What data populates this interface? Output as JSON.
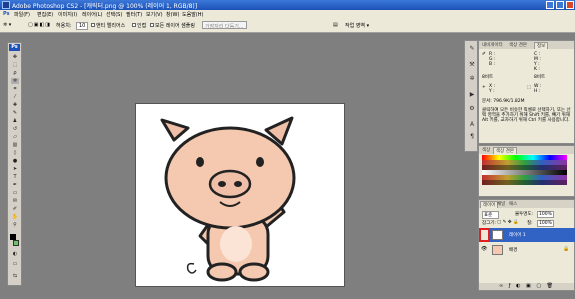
{
  "window": {
    "title": "Adobe Photoshop CS2 - [캐릭터.png @ 100% (레이어 1, RGB/8)]"
  },
  "menu": [
    "파일(F)",
    "편집(E)",
    "이미지(I)",
    "레이어(L)",
    "선택(S)",
    "필터(T)",
    "보기(V)",
    "창(W)",
    "도움말(H)"
  ],
  "options": {
    "tolerance_label": "허용치:",
    "tolerance_value": "10",
    "antialias": "앤티 앨리어스",
    "contiguous": "인접",
    "all_layers": "모든 레이어 샘플링",
    "refine_edge": "가장자리 다듬기...",
    "workspace": "작업 영역 ▾"
  },
  "panels": {
    "navigator": {
      "tabs": [
        "내비게이터",
        "색상 견본",
        "정보"
      ],
      "info": {
        "r": "R :",
        "g": "G :",
        "b": "B :",
        "c": "C :",
        "m": "M :",
        "y": "Y :",
        "k": "K :",
        "bit1": "8비트",
        "bit2": "8비트",
        "x": "X :",
        "y2": "Y :",
        "w": "W :",
        "h": "H :"
      },
      "doc": "문서: 796.9K/1.82M",
      "hint": "클릭하여 모든 비슷한 픽셀로 선택하기, 또는 선택 영역을 추가하기 위해 Shift 키를, 빼기 위해 Alt 키를, 교차하기 위해 Ctrl 키를 사용합니다."
    },
    "swatches": {
      "tabs": [
        "색상",
        "색상 견본"
      ]
    },
    "layers": {
      "tabs": [
        "레이어",
        "채널",
        "패스"
      ],
      "blend": "표준",
      "opacity_label": "불투명도:",
      "opacity_value": "100%",
      "lock_label": "잠그기:",
      "fill_label": "칠:",
      "fill_value": "100%",
      "items": [
        {
          "name": "레이어 1",
          "selected": true
        },
        {
          "name": "배경",
          "selected": false
        }
      ]
    }
  }
}
